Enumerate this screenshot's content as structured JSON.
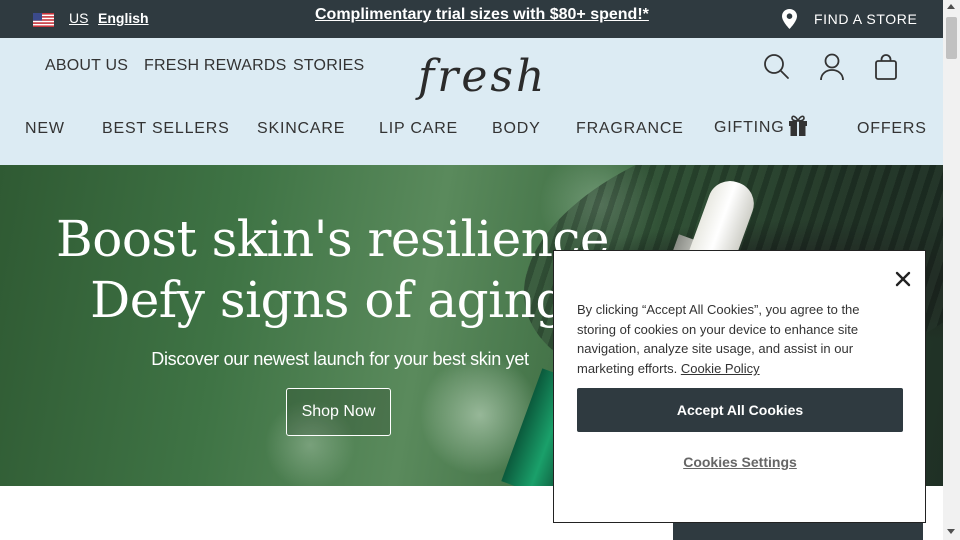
{
  "topbar": {
    "country": "US",
    "language": "English",
    "promo": "Complimentary trial sizes with $80+ spend!*",
    "find_store": "FIND A STORE"
  },
  "header": {
    "utility_links": [
      "ABOUT US",
      "FRESH REWARDS",
      "STORIES"
    ],
    "logo": "fresh",
    "icons": [
      "search-icon",
      "account-icon",
      "bag-icon"
    ]
  },
  "nav": {
    "items": [
      "NEW",
      "BEST SELLERS",
      "SKINCARE",
      "LIP CARE",
      "BODY",
      "FRAGRANCE",
      "GIFTING",
      "OFFERS"
    ]
  },
  "hero": {
    "title_line1": "Boost skin's resilience",
    "title_line2": "Defy signs of aging",
    "subtitle": "Discover our newest launch for your best skin yet",
    "cta": "Shop Now"
  },
  "cookie_dialog": {
    "text": "By clicking “Accept All Cookies”, you agree to the storing of cookies on your device to enhance site navigation, analyze site usage, and assist in our marketing efforts.",
    "policy_link": "Cookie Policy",
    "accept_label": "Accept All Cookies",
    "settings_label": "Cookies Settings"
  },
  "colors": {
    "topbar_bg": "#2f3a40",
    "header_bg": "#dcebf3",
    "accept_bg": "#2f3a40"
  }
}
